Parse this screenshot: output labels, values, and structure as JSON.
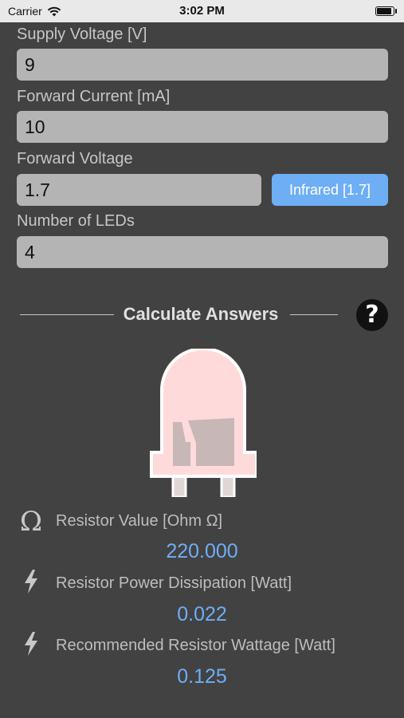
{
  "status_bar": {
    "carrier": "Carrier",
    "time": "3:02 PM"
  },
  "inputs": {
    "supply_voltage": {
      "label": "Supply Voltage [V]",
      "value": "9"
    },
    "forward_current": {
      "label": "Forward Current [mA]",
      "value": "10"
    },
    "forward_voltage": {
      "label": "Forward Voltage",
      "value": "1.7",
      "preset_button": "Infrared [1.7]"
    },
    "num_leds": {
      "label": "Number of LEDs",
      "value": "4"
    }
  },
  "calculate": {
    "label": "Calculate Answers",
    "help": "?"
  },
  "results": {
    "resistor_value": {
      "icon": "omega-icon",
      "symbol": "Ω",
      "label": "Resistor Value [Ohm Ω]",
      "value": "220.000"
    },
    "power_dissipation": {
      "icon": "lightning-icon",
      "label": "Resistor Power Dissipation [Watt]",
      "value": "0.022"
    },
    "recommended_wattage": {
      "icon": "lightning-icon",
      "label": "Recommended Resistor Wattage [Watt]",
      "value": "0.125"
    }
  },
  "colors": {
    "background": "#424242",
    "accent": "#6eaef5",
    "field": "#b4b4b4",
    "led": "#ffdada"
  }
}
